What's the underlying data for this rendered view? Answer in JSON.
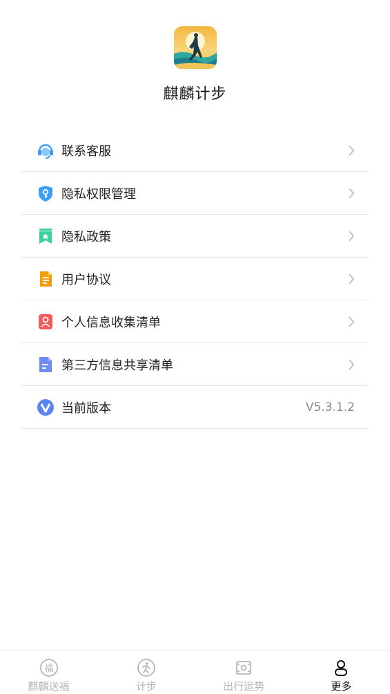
{
  "app": {
    "name": "麒麟计步"
  },
  "menu": {
    "items": [
      {
        "label": "联系客服",
        "icon": "headset-icon",
        "color": "#3B9DF5"
      },
      {
        "label": "隐私权限管理",
        "icon": "shield-key-icon",
        "color": "#3B9DF5"
      },
      {
        "label": "隐私政策",
        "icon": "bookmark-star-icon",
        "color": "#34D399"
      },
      {
        "label": "用户协议",
        "icon": "document-icon",
        "color": "#F59E0B"
      },
      {
        "label": "个人信息收集清单",
        "icon": "person-card-icon",
        "color": "#F05A5A"
      },
      {
        "label": "第三方信息共享清单",
        "icon": "file-lines-icon",
        "color": "#6B8CF5"
      },
      {
        "label": "当前版本",
        "icon": "version-v-icon",
        "color": "#5B86F2",
        "value": "V5.3.1.2"
      }
    ]
  },
  "tabbar": {
    "tabs": [
      {
        "label": "麒麟送福",
        "icon": "fu-icon",
        "active": false
      },
      {
        "label": "计步",
        "icon": "walking-icon",
        "active": false
      },
      {
        "label": "出行运势",
        "icon": "fortune-icon",
        "active": false
      },
      {
        "label": "更多",
        "icon": "user-icon",
        "active": true
      }
    ]
  },
  "colors": {
    "divider": "#e6e6e6",
    "inactive": "#b5b5b5",
    "active": "#111111"
  }
}
